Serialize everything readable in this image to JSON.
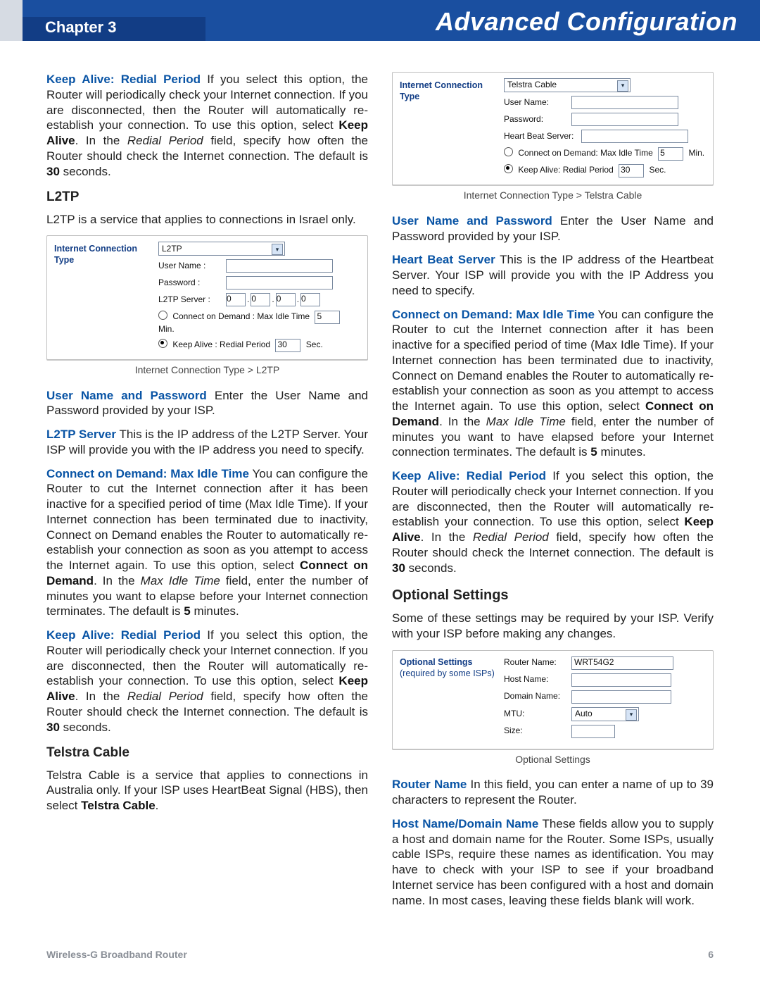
{
  "header": {
    "chapter": "Chapter 3",
    "title": "Advanced Configuration"
  },
  "footer": {
    "product": "Wireless-G Broadband Router",
    "page": "6"
  },
  "left": {
    "p_keepalive_top": {
      "term": "Keep Alive: Redial Period",
      "body": "  If you select this option, the Router will periodically check your Internet connection. If you are disconnected, then the Router will automatically re-establish your connection. To use this option, select ",
      "bold1": "Keep Alive",
      "body2": ". In the ",
      "ital": "Redial Period",
      "body3": " field, specify how often the Router should check the Internet connection. The default is ",
      "bold2": "30",
      "body4": " seconds."
    },
    "h_l2tp": "L2TP",
    "p_l2tp_intro": "L2TP is a service that applies to connections in Israel only.",
    "fig_l2tp": {
      "panel_label": "Internet Connection Type",
      "select_value": "L2TP",
      "rows": {
        "user": "User Name :",
        "pass": "Password :",
        "server": "L2TP Server :",
        "ip": [
          "0",
          "0",
          "0",
          "0"
        ],
        "cod": "Connect on Demand : Max Idle Time",
        "cod_val": "5",
        "cod_unit": "Min.",
        "ka": "Keep Alive : Redial Period",
        "ka_val": "30",
        "ka_unit": "Sec."
      },
      "caption": "Internet Connection Type > L2TP"
    },
    "p_userpass": {
      "term": "User Name and Password",
      "body": "  Enter the User Name and Password provided by your ISP."
    },
    "p_l2tpsrv": {
      "term": "L2TP Server",
      "body": "  This is the IP address of the L2TP Server. Your ISP will provide you with the IP address you need to specify."
    },
    "p_cod": {
      "term": "Connect on Demand: Max Idle Time",
      "body": "  You can configure the Router to cut the Internet connection after it has been inactive for a specified period of time (Max Idle Time). If your Internet connection has been terminated due to inactivity, Connect on Demand enables the Router to automatically re-establish your connection as soon as you attempt to access the Internet again. To use this option, select ",
      "bold1": "Connect on Demand",
      "body2": ". In the ",
      "ital": "Max Idle Time",
      "body3": " field, enter the number of minutes you want to elapse before your Internet connection terminates. The default is ",
      "bold2": "5",
      "body4": " minutes."
    },
    "p_ka2": {
      "term": "Keep Alive: Redial Period",
      "body": "  If you select this option, the Router will periodically check your Internet connection. If you are disconnected, then the Router will automatically re-establish your connection. To use this option, select ",
      "bold1": "Keep Alive",
      "body2": ". In the ",
      "ital": "Redial Period",
      "body3": " field, specify how often the Router should check the Internet connection. The default is ",
      "bold2": "30",
      "body4": " seconds."
    },
    "h_telstra": "Telstra Cable",
    "p_telstra": {
      "pre": "Telstra Cable is a service that applies to connections in Australia only. If your ISP uses HeartBeat Signal (HBS), then select ",
      "bold": "Telstra Cable",
      "post": "."
    }
  },
  "right": {
    "fig_telstra": {
      "panel_label": "Internet Connection Type",
      "select_value": "Telstra Cable",
      "rows": {
        "user": "User Name:",
        "pass": "Password:",
        "hbs": "Heart Beat Server:",
        "cod": "Connect on Demand: Max Idle Time",
        "cod_val": "5",
        "cod_unit": "Min.",
        "ka": "Keep Alive: Redial Period",
        "ka_val": "30",
        "ka_unit": "Sec."
      },
      "caption": "Internet Connection Type > Telstra Cable"
    },
    "p_userpass": {
      "term": "User Name and Password",
      "body": "  Enter the User Name and Password provided by your ISP."
    },
    "p_hbs": {
      "term": "Heart Beat Server",
      "body": "  This is the IP address of the Heartbeat Server. Your ISP will provide you with the IP Address you need to specify."
    },
    "p_cod": {
      "term": "Connect on Demand: Max Idle Time",
      "body": "  You can configure the Router to cut the Internet connection after it has been inactive for a specified period of time (Max Idle Time). If your Internet connection has been terminated due to inactivity, Connect on Demand enables the Router to automatically re-establish your connection as soon as you attempt to access the Internet again. To use this option, select ",
      "bold1": "Connect on Demand",
      "body2": ". In the ",
      "ital": "Max Idle Time",
      "body3": " field, enter the number of minutes you want to have elapsed before your Internet connection terminates. The default is ",
      "bold2": "5",
      "body4": " minutes."
    },
    "p_ka": {
      "term": "Keep Alive: Redial Period",
      "body": "  If you select this option, the Router will periodically check your Internet connection. If you are disconnected, then the Router will automatically re-establish your connection. To use this option, select ",
      "bold1": "Keep Alive",
      "body2": ". In the ",
      "ital": "Redial Period",
      "body3": " field, specify how often the Router should check the Internet connection. The default is ",
      "bold2": "30",
      "body4": " seconds."
    },
    "h_optional": "Optional Settings",
    "p_optional_intro": "Some of these settings may be required by your ISP. Verify with your ISP before making any changes.",
    "fig_optional": {
      "panel_label1": "Optional Settings",
      "panel_label2": "(required by some ISPs)",
      "rows": {
        "router": "Router Name:",
        "router_val": "WRT54G2",
        "host": "Host Name:",
        "domain": "Domain Name:",
        "mtu": "MTU:",
        "mtu_val": "Auto",
        "size": "Size:"
      },
      "caption": "Optional Settings"
    },
    "p_router_name": {
      "term": "Router Name",
      "body": "  In this field, you can enter a name of up to 39 characters to represent the Router."
    },
    "p_hostdomain": {
      "term": "Host Name/Domain Name",
      "body": "  These fields allow you to supply a host and domain name for the Router. Some ISPs, usually cable ISPs, require these names as identification. You may have to check with your ISP to see if your broadband Internet service has been configured with a host and domain name. In most cases, leaving these fields blank will work."
    }
  }
}
